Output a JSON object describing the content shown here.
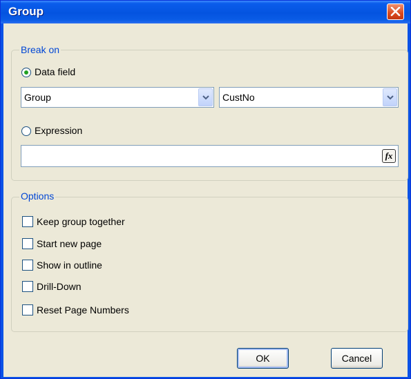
{
  "window": {
    "title": "Group"
  },
  "break_on": {
    "legend": "Break on",
    "data_field_label": "Data field",
    "data_field_checked": true,
    "combo1_value": "Group",
    "combo2_value": "CustNo",
    "expression_label": "Expression",
    "expression_checked": false,
    "expression_value": "",
    "fx_label": "fx"
  },
  "options": {
    "legend": "Options",
    "items": [
      {
        "label": "Keep group together",
        "checked": false
      },
      {
        "label": "Start new page",
        "checked": false
      },
      {
        "label": "Show in outline",
        "checked": false
      },
      {
        "label": "Drill-Down",
        "checked": false
      },
      {
        "label": "Reset Page Numbers",
        "checked": false
      }
    ]
  },
  "buttons": {
    "ok": "OK",
    "cancel": "Cancel"
  }
}
